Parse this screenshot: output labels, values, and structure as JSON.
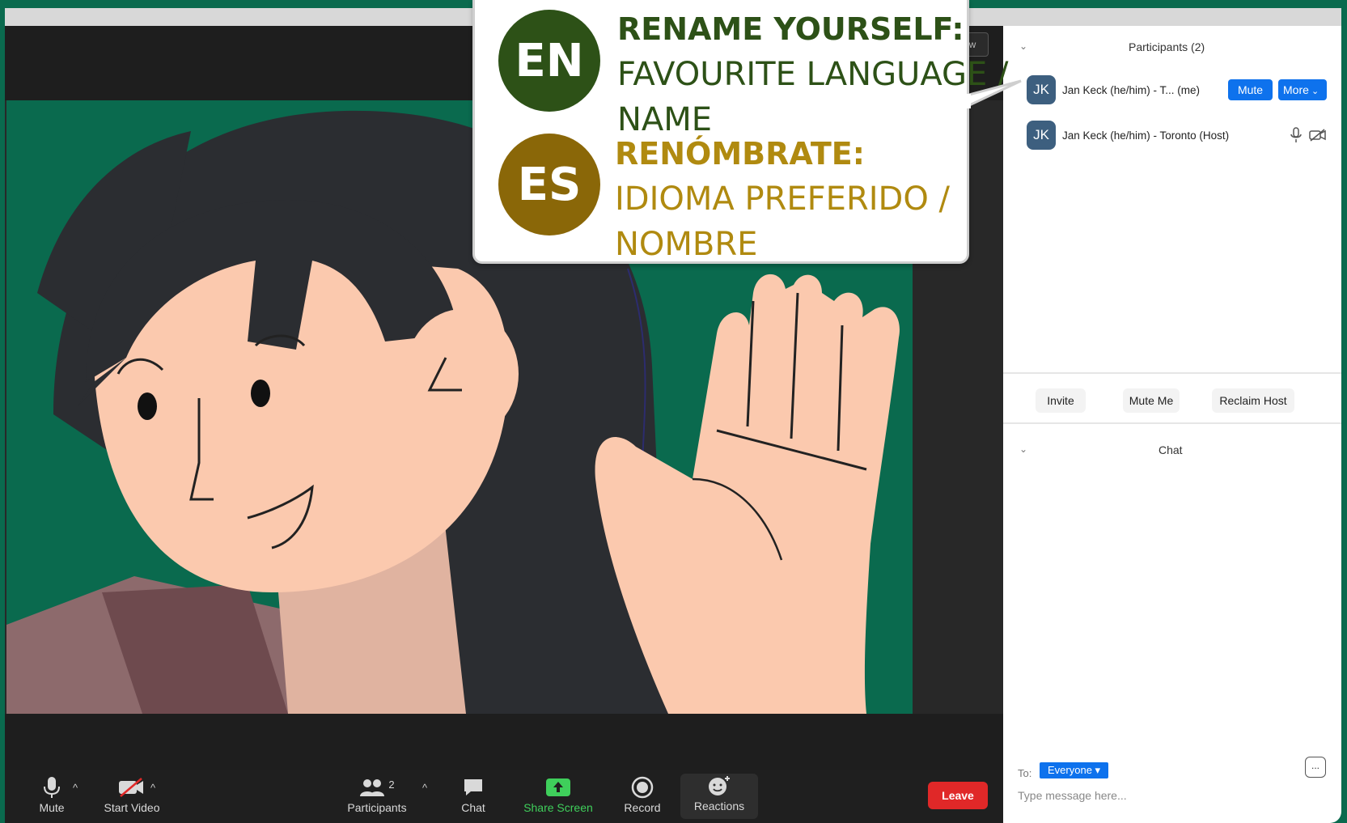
{
  "colors": {
    "frame_green": "#0a6a4e",
    "en_green": "#2d5117",
    "es_gold": "#8a6708",
    "es_text": "#b08a10",
    "zoom_blue": "#0e72ed",
    "leave_red": "#e02828",
    "share_green": "#3fcf5b"
  },
  "video": {
    "view_label": "w"
  },
  "callout": {
    "en": {
      "badge": "EN",
      "title": "RENAME YOURSELF:",
      "line1": "FAVOURITE LANGUAGE /",
      "line2": "NAME"
    },
    "es": {
      "badge": "ES",
      "title": "RENÓMBRATE:",
      "line1": "IDIOMA PREFERIDO /",
      "line2": "NOMBRE"
    }
  },
  "toolbar": {
    "mute": "Mute",
    "start_video": "Start Video",
    "participants": "Participants",
    "participants_count": "2",
    "chat": "Chat",
    "share_screen": "Share Screen",
    "record": "Record",
    "reactions": "Reactions",
    "leave": "Leave"
  },
  "participants_panel": {
    "title": "Participants (2)",
    "items": [
      {
        "initials": "JK",
        "name": "Jan Keck (he/him) - T... (me)",
        "mute_label": "Mute",
        "more_label": "More"
      },
      {
        "initials": "JK",
        "name": "Jan Keck (he/him) - Toronto (Host)"
      }
    ],
    "buttons": {
      "invite": "Invite",
      "mute_me": "Mute Me",
      "reclaim_host": "Reclaim Host"
    }
  },
  "chat_panel": {
    "title": "Chat",
    "to_label": "To:",
    "to_value": "Everyone ▾",
    "more": "...",
    "placeholder": "Type message here..."
  }
}
